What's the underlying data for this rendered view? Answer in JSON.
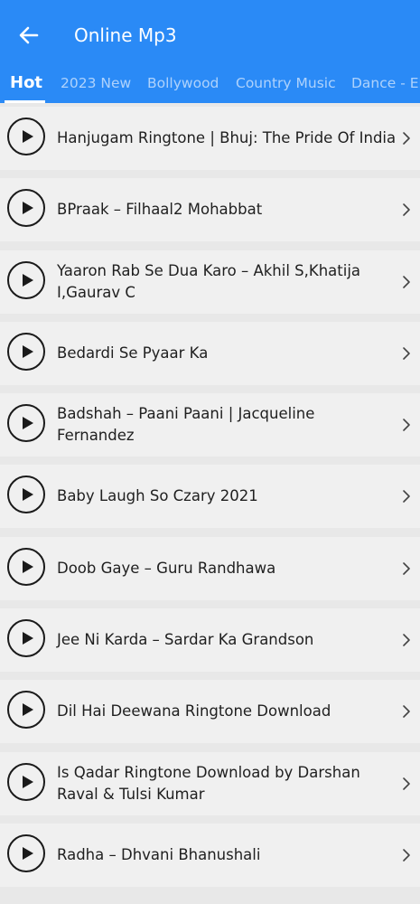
{
  "header": {
    "title": "Online Mp3",
    "back_icon": "arrow-left-icon"
  },
  "tabs": [
    {
      "label": "Hot",
      "active": true
    },
    {
      "label": "2023 New",
      "active": false
    },
    {
      "label": "Bollywood",
      "active": false
    },
    {
      "label": "Country Music",
      "active": false
    },
    {
      "label": "Dance - Ele",
      "active": false
    }
  ],
  "songs": [
    {
      "title": "Hanjugam Ringtone | Bhuj: The Pride Of India"
    },
    {
      "title": "BPraak – Filhaal2 Mohabbat"
    },
    {
      "title": "Yaaron Rab Se Dua Karo – Akhil S,Khatija I,Gaurav C"
    },
    {
      "title": "Bedardi Se Pyaar Ka"
    },
    {
      "title": "Badshah – Paani Paani | Jacqueline Fernandez"
    },
    {
      "title": "Baby Laugh So Czary 2021"
    },
    {
      "title": "Doob Gaye – Guru Randhawa"
    },
    {
      "title": "Jee Ni Karda – Sardar Ka Grandson"
    },
    {
      "title": "Dil Hai Deewana Ringtone Download"
    },
    {
      "title": "Is Qadar Ringtone Download by Darshan Raval & Tulsi Kumar"
    },
    {
      "title": "Radha – Dhvani Bhanushali"
    }
  ],
  "icons": {
    "play": "play-icon",
    "chevron": "chevron-right-icon"
  },
  "colors": {
    "accent": "#2a8af6",
    "row_background": "#f0f0f0",
    "page_background": "#e8e8e8"
  }
}
